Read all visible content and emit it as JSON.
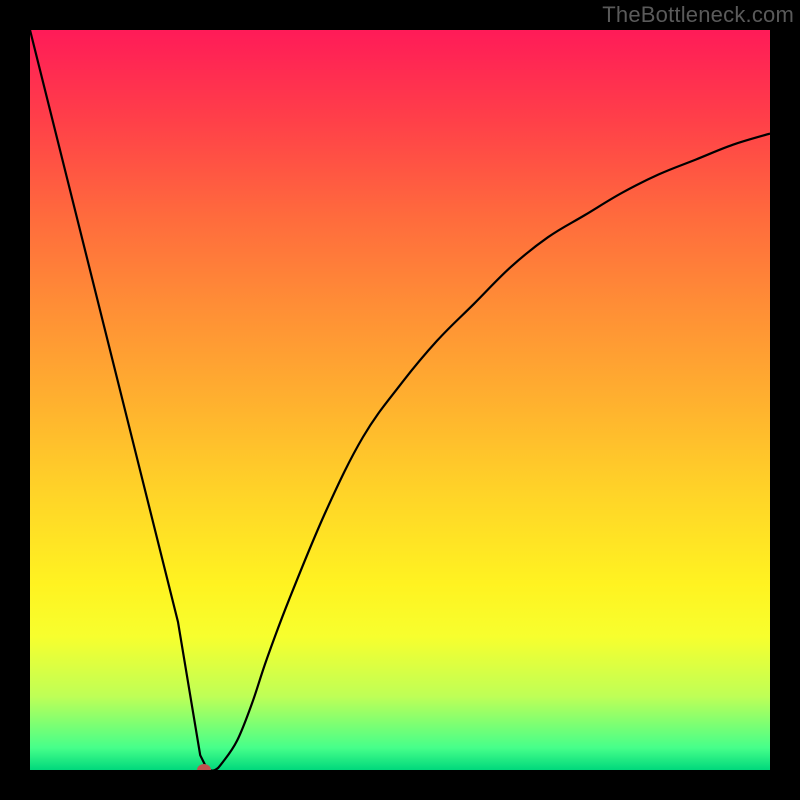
{
  "watermark": "TheBottleneck.com",
  "colors": {
    "frame_bg": "#000000",
    "gradient_top": "#ff1b58",
    "gradient_bottom": "#00d87c",
    "curve": "#000000",
    "marker": "#c0524f"
  },
  "chart_data": {
    "type": "line",
    "title": "",
    "xlabel": "",
    "ylabel": "",
    "xlim": [
      0,
      100
    ],
    "ylim": [
      0,
      100
    ],
    "annotations": [],
    "series": [
      {
        "name": "bottleneck-curve",
        "x": [
          0,
          5,
          10,
          15,
          20,
          22,
          23,
          24,
          25,
          26,
          28,
          30,
          32,
          35,
          40,
          45,
          50,
          55,
          60,
          65,
          70,
          75,
          80,
          85,
          90,
          95,
          100
        ],
        "values": [
          100,
          80,
          60,
          40,
          20,
          8,
          2,
          0,
          0,
          1,
          4,
          9,
          15,
          23,
          35,
          45,
          52,
          58,
          63,
          68,
          72,
          75,
          78,
          80.5,
          82.5,
          84.5,
          86
        ]
      }
    ],
    "marker": {
      "x": 23.5,
      "y": 0
    },
    "grid": false,
    "legend": false
  }
}
